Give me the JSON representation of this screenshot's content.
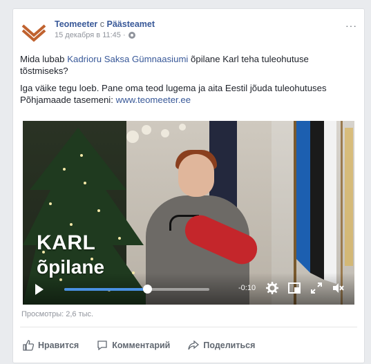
{
  "post": {
    "page_name": "Teomeeter",
    "conjunction": "с",
    "partner_name": "Päästeamet",
    "meta_date": "15 декабря в 11:45 ·",
    "more_label": "···",
    "text_parts": {
      "p1_before": "Mida lubab ",
      "p1_link": "Kadrioru Saksa Gümnaasiumi",
      "p1_after": " õpilane Karl teha tuleohutuse tõstmiseks?",
      "p2_before": "Iga väike tegu loeb. Pane oma teod lugema ja aita Eestil jõuda tuleohutuses Põhjamaade tasemeni: ",
      "p2_link": "www.teomeeter.ee"
    }
  },
  "video": {
    "overlay_title": "KARL",
    "overlay_subtitle": "õpilane",
    "time_remaining": "-0:10",
    "progress_fraction": 0.57,
    "icons": [
      "play-icon",
      "settings-icon",
      "picture-in-picture-icon",
      "fullscreen-icon",
      "mute-icon"
    ]
  },
  "stats": {
    "views": "Просмотры: 2,6 тыс."
  },
  "actions": {
    "like": "Нравится",
    "comment": "Комментарий",
    "share": "Поделиться"
  },
  "colors": {
    "link": "#385898",
    "progress": "#4a90e2",
    "logo_accent": "#c0622f"
  }
}
